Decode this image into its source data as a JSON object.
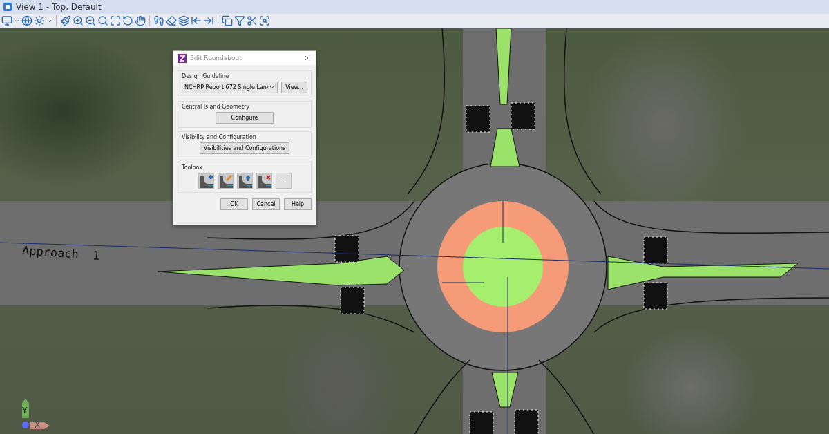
{
  "window": {
    "title": "View 1 - Top, Default"
  },
  "canvas": {
    "label": "Approach  1",
    "axis": {
      "y": "Y",
      "x": "X"
    }
  },
  "dialog": {
    "title": "Edit Roundabout",
    "sections": [
      {
        "kind": "dropdown",
        "title": "Design Guideline",
        "value": "NCHRP Report 672 Single Lan‹",
        "button": "View..."
      },
      {
        "kind": "button",
        "title": "Central Island Geometry",
        "button": "Configure"
      },
      {
        "kind": "button",
        "title": "Visibility and Configuration",
        "button": "Visibilities and Configurations"
      },
      {
        "kind": "toolbox",
        "title": "Toolbox",
        "more": "..."
      }
    ],
    "buttons": [
      "OK",
      "Cancel",
      "Help"
    ]
  }
}
